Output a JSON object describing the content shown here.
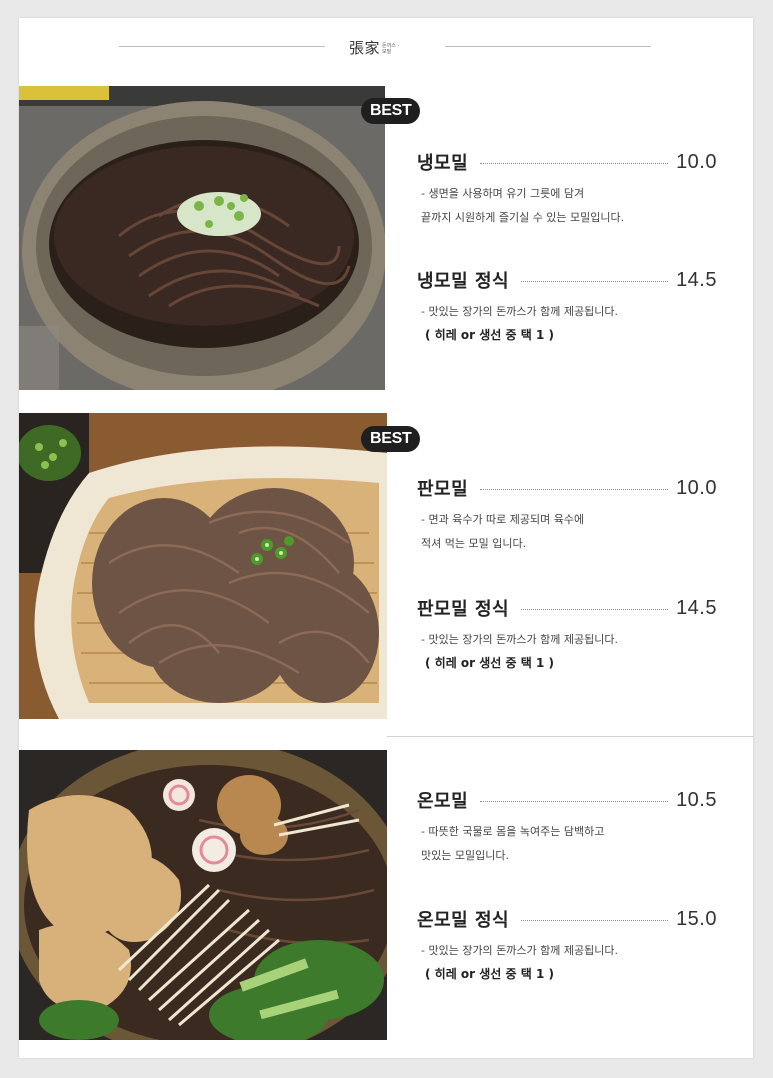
{
  "header": {
    "logo_main": "張家",
    "logo_sub": "돈까스 · 모밀"
  },
  "sections": [
    {
      "badge": "BEST",
      "items": [
        {
          "name": "냉모밀",
          "price": "10.0",
          "desc_1": "- 생면을 사용하며 유기 그릇에 담겨",
          "desc_2": "끝까지 시원하게 즐기실 수 있는 모밀입니다."
        },
        {
          "name": "냉모밀 정식",
          "price": "14.5",
          "desc_1": "- 맛있는 장가의 돈까스가 함께 제공됩니다.",
          "note": "( 히레 or 생선 중 택 1 )"
        }
      ]
    },
    {
      "badge": "BEST",
      "items": [
        {
          "name": "판모밀",
          "price": "10.0",
          "desc_1": "- 면과 육수가 따로 제공되며 육수에",
          "desc_2": "적셔 먹는 모밀 입니다."
        },
        {
          "name": "판모밀 정식",
          "price": "14.5",
          "desc_1": "- 맛있는 장가의 돈까스가 함께 제공됩니다.",
          "note": "( 히레 or 생선 중 택 1 )"
        }
      ]
    },
    {
      "items": [
        {
          "name": "온모밀",
          "price": "10.5",
          "desc_1": "- 따뜻한 국물로 몸을 녹여주는 담백하고",
          "desc_2": "맛있는 모밀입니다."
        },
        {
          "name": "온모밀 정식",
          "price": "15.0",
          "desc_1": "- 맛있는 장가의 돈까스가 함께 제공됩니다.",
          "note": "( 히레 or 생선 중 택 1 )"
        }
      ]
    }
  ]
}
